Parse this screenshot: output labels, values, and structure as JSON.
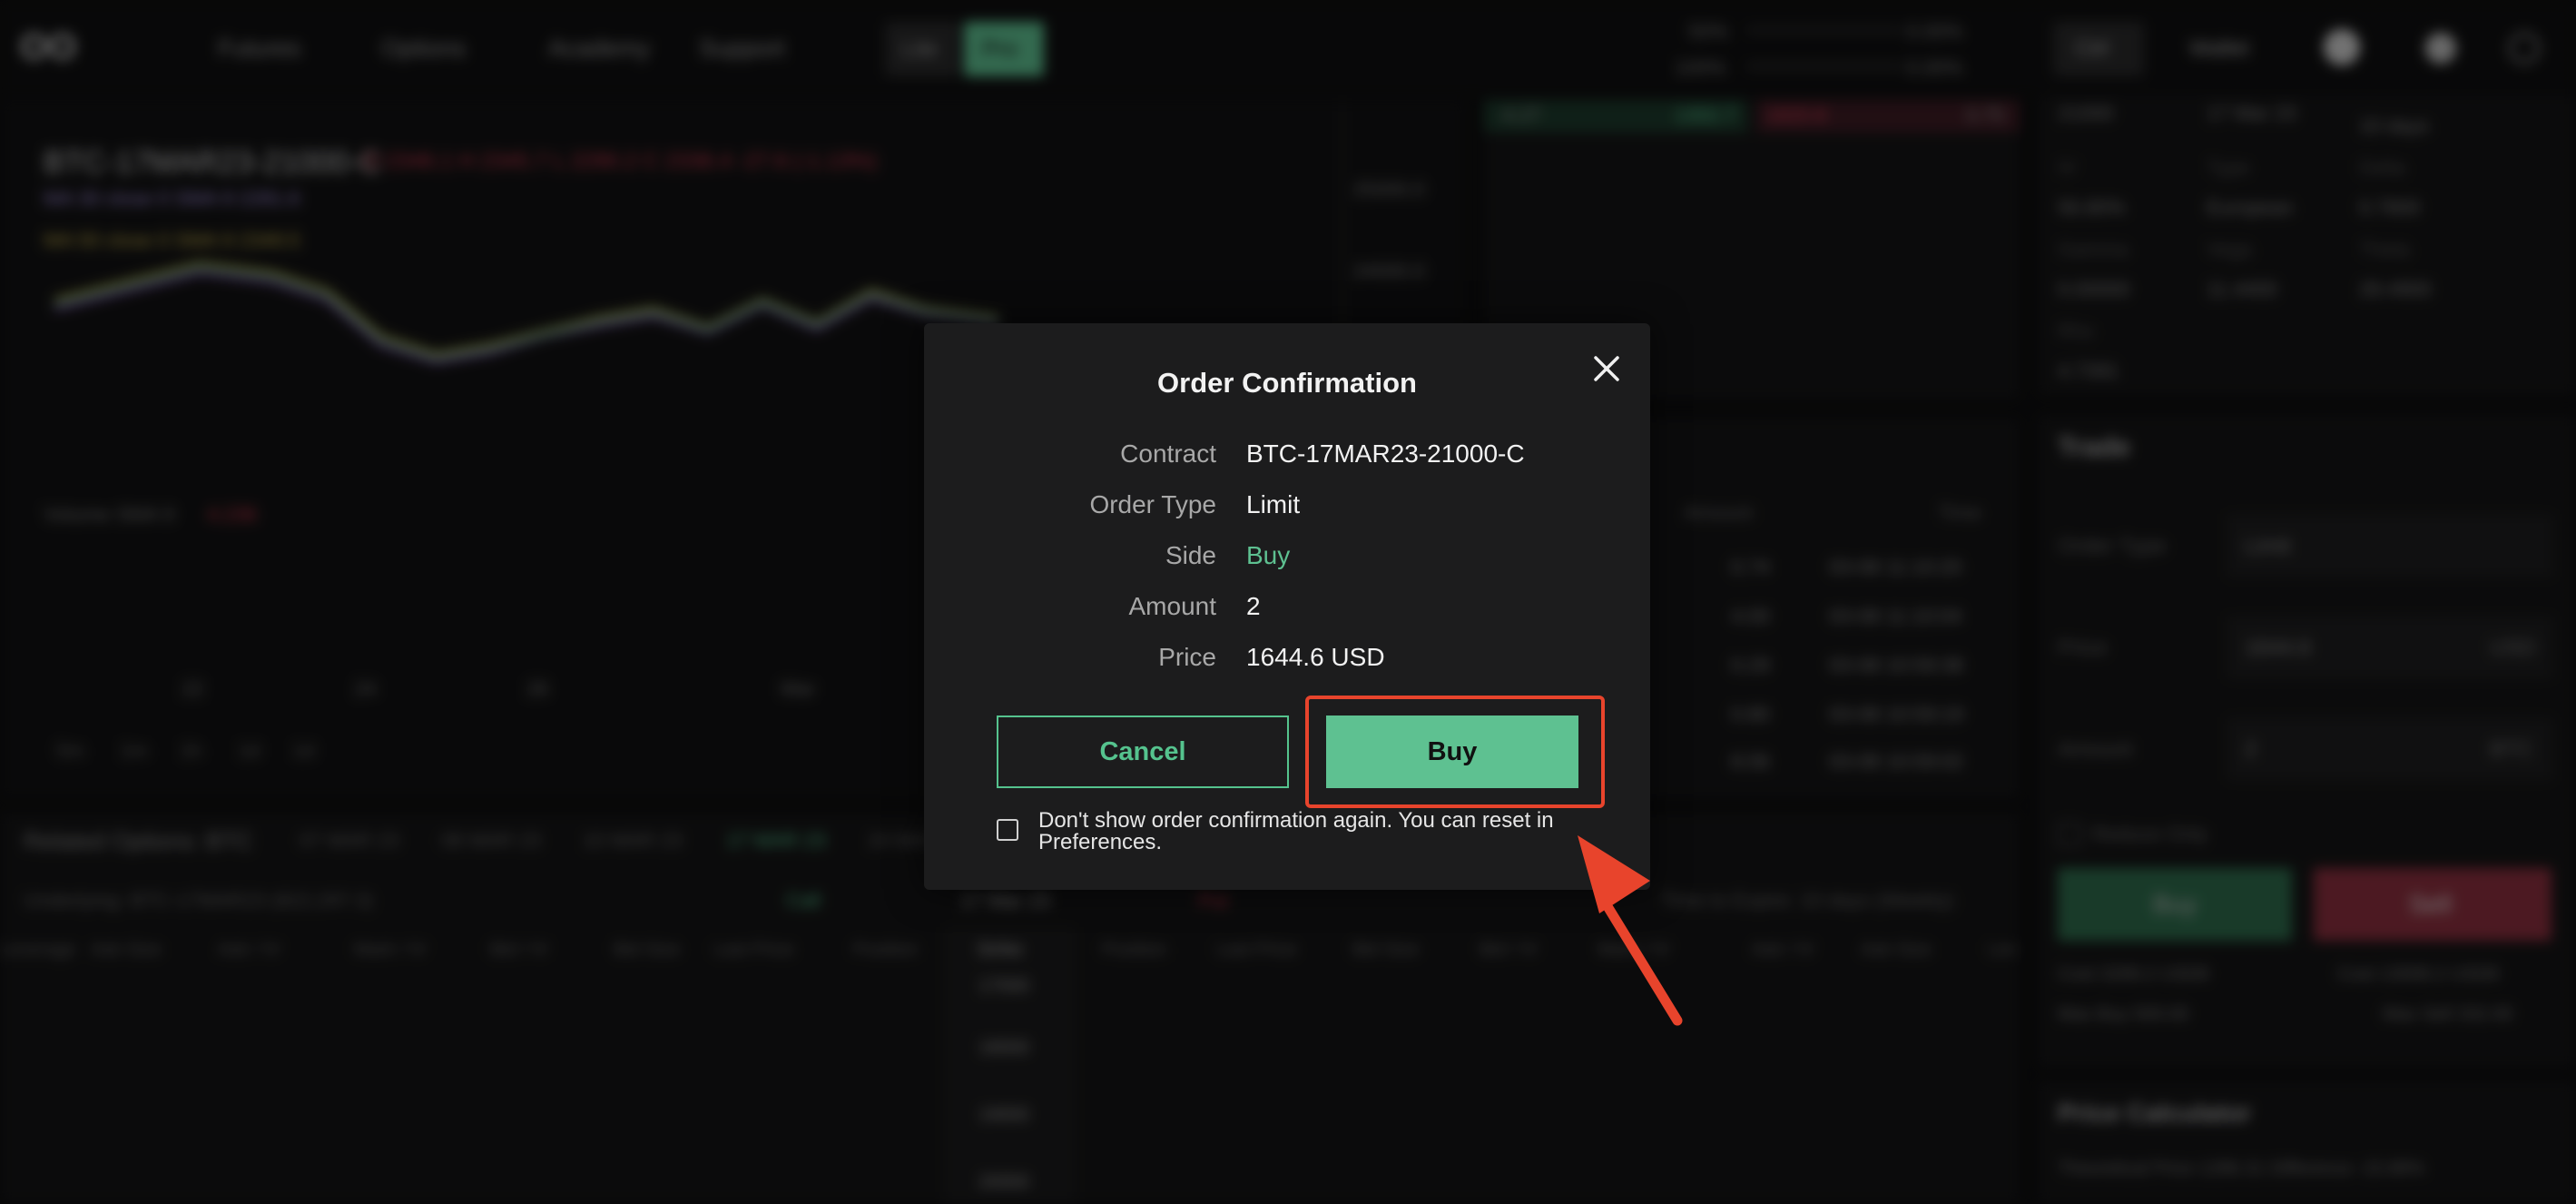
{
  "nav": {
    "logo": "OO",
    "items": [
      "Futures",
      "Options",
      "Academy",
      "Support"
    ],
    "mode_lite": "Lite",
    "mode_pro": "Pro",
    "metric1_pct": "50%",
    "metric1_val": "0.00%",
    "metric2_pct": "100%",
    "metric2_val": "0.00%",
    "btn_one": "Ctrl",
    "btn_two": "Wallet"
  },
  "chart": {
    "symbol": "BTC-17MAR23-21000-C",
    "ohlc": "O 2346.1  H 2345.7  L 2290.2  C 2336.4  -27.6 (-1.13%)",
    "ma1": "MA 30 close 0 SMA 9  2281.6",
    "ma2": "MA 50 close 0 SMA 9  2349.5",
    "price_tick1": "25000.0",
    "price_tick2": "24000.0",
    "volume_label": "Volume SMA 9",
    "volume_val": "4.236",
    "x_ticks": [
      "22",
      "24",
      "26",
      "Mar"
    ],
    "ranges": [
      "5m",
      "1m",
      "1h",
      "1d",
      "1d"
    ]
  },
  "orderbook": {
    "header": [
      "4.27",
      "1302.7",
      "1820.8",
      "3.75"
    ]
  },
  "trades": {
    "header_amount": "Amount",
    "header_time": "Time",
    "rows": [
      [
        "0.74",
        "03-08 11:10:20"
      ],
      [
        "4.00",
        "03-08 11:10:04"
      ],
      [
        "0.29",
        "03-08 10:59:38"
      ],
      [
        "0.80",
        "03-08 10:59:19"
      ],
      [
        "8.56",
        "03-08 10:59:02"
      ]
    ]
  },
  "info": {
    "strike": "21000",
    "expiry": "17 Mar 23",
    "days": "10 days",
    "iv_label": "IV",
    "iv": "56.80%",
    "type_label": "Type",
    "type": "European",
    "delta_label": "Delta",
    "delta": "0.7800",
    "gamma_label": "Gamma",
    "gamma": "0.00000",
    "vega_label": "Vega",
    "vega": "11.4400",
    "theta_label": "Theta",
    "theta": "28.4900",
    "rho_label": "Rho",
    "rho": "4.7391"
  },
  "trade": {
    "title": "Trade",
    "order_type_label": "Order Type",
    "order_type": "Limit",
    "price_label": "Price",
    "price": "1644.6",
    "price_unit": "USD",
    "amount_label": "Amount",
    "amount": "2",
    "amount_unit": "BTC",
    "reduce_only": "Reduce Only",
    "buy": "Buy",
    "sell": "Sell",
    "cost_left": "Cost 3289.2 USD8",
    "cost_right": "Cost 13008.2 USD8",
    "max_buy": "Max Buy 500.00",
    "max_sell": "Max Sell 332.00",
    "calc_title": "Price Calculator",
    "calc_line": "Theoretical Price 1286.31   Difference -15.88%"
  },
  "related": {
    "title": "Related Options: BTC",
    "dates": [
      "07 MAR 23",
      "08 MAR 23",
      "10 MAR 23",
      "17 MAR 23",
      "24 MAR 23"
    ],
    "underlying": "Underlying: BTC-17MAR23 (822,297.3)",
    "call": "Call",
    "mid": "17 Mar 23",
    "put": "Put",
    "expire": "Time to Expire: 10 days (Weekly)",
    "columns": [
      "Leverage",
      "Ask Size",
      "Ask / IV",
      "Mark / IV",
      "Bid / IV",
      "Bid Size",
      "Last Price",
      "Position",
      "Strike",
      "Position",
      "Last Price",
      "Bid Size",
      "Bid / IV",
      "Mark / IV",
      "Ask / IV",
      "Ask Size",
      "Lev"
    ],
    "strikes": [
      "17000",
      "18000",
      "19000",
      "20000"
    ]
  },
  "modal": {
    "title": "Order Confirmation",
    "rows": [
      {
        "label": "Contract",
        "value": "BTC-17MAR23-21000-C"
      },
      {
        "label": "Order Type",
        "value": "Limit"
      },
      {
        "label": "Side",
        "value": "Buy"
      },
      {
        "label": "Amount",
        "value": "2"
      },
      {
        "label": "Price",
        "value": "1644.6 USD"
      }
    ],
    "cancel": "Cancel",
    "buy": "Buy",
    "checkbox_text": "Don't show order confirmation again. You can reset in Preferences.",
    "accent": "#5ec191",
    "highlight_color": "#e8442c"
  }
}
